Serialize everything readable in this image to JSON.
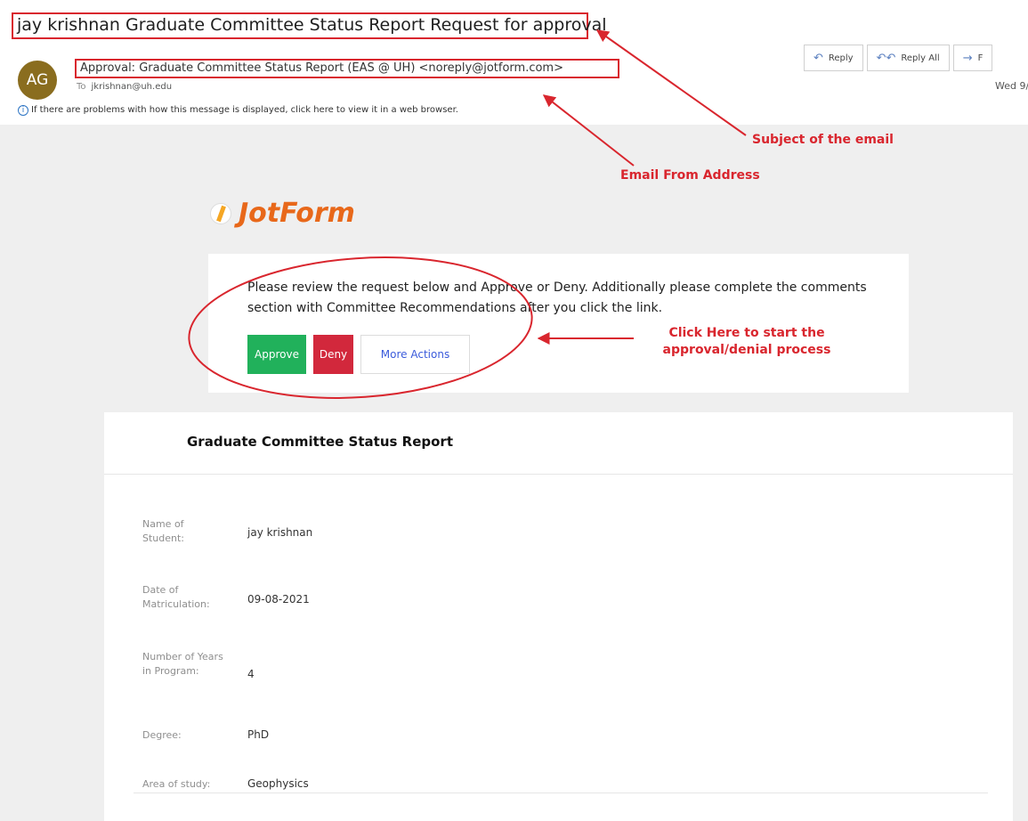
{
  "email": {
    "subject": "jay krishnan Graduate Committee Status Report Request for approval",
    "avatar_initials": "AG",
    "from": "Approval: Graduate Committee Status Report (EAS @ UH) <noreply@jotform.com>",
    "to_label": "To",
    "to": "jkrishnan@uh.edu",
    "info": "If there are problems with how this message is displayed, click here to view it in a web browser.",
    "date": "Wed 9/",
    "actions": {
      "reply": "Reply",
      "reply_all": "Reply All",
      "forward": "F"
    }
  },
  "annotations": {
    "subject": "Subject of the email",
    "from": "Email From Address",
    "click": "Click Here to start the approval/denial process"
  },
  "jotform": {
    "logo_text": "JotForm",
    "message": "Please review the request below and Approve or Deny. Additionally please complete the comments section with Committee Recommendations after you click the link.",
    "buttons": {
      "approve": "Approve",
      "deny": "Deny",
      "more": "More Actions"
    }
  },
  "report": {
    "title": "Graduate Committee Status Report",
    "fields": [
      {
        "label": "Name of Student:",
        "value": "jay krishnan"
      },
      {
        "label": "Date of Matriculation:",
        "value": "09-08-2021"
      },
      {
        "label": "Number of Years in Program:",
        "value": "4"
      },
      {
        "label": "Degree:",
        "value": "PhD"
      },
      {
        "label": "Area of study:",
        "value": "Geophysics"
      }
    ]
  },
  "colors": {
    "annotation_red": "#d9262e",
    "approve_green": "#21b15b",
    "deny_red": "#d2283c",
    "jotform_orange": "#e8681a",
    "avatar_brown": "#8a6d1f"
  },
  "icons": [
    "reply-icon",
    "reply-all-icon",
    "forward-icon",
    "info-icon",
    "jotform-logo-icon"
  ]
}
